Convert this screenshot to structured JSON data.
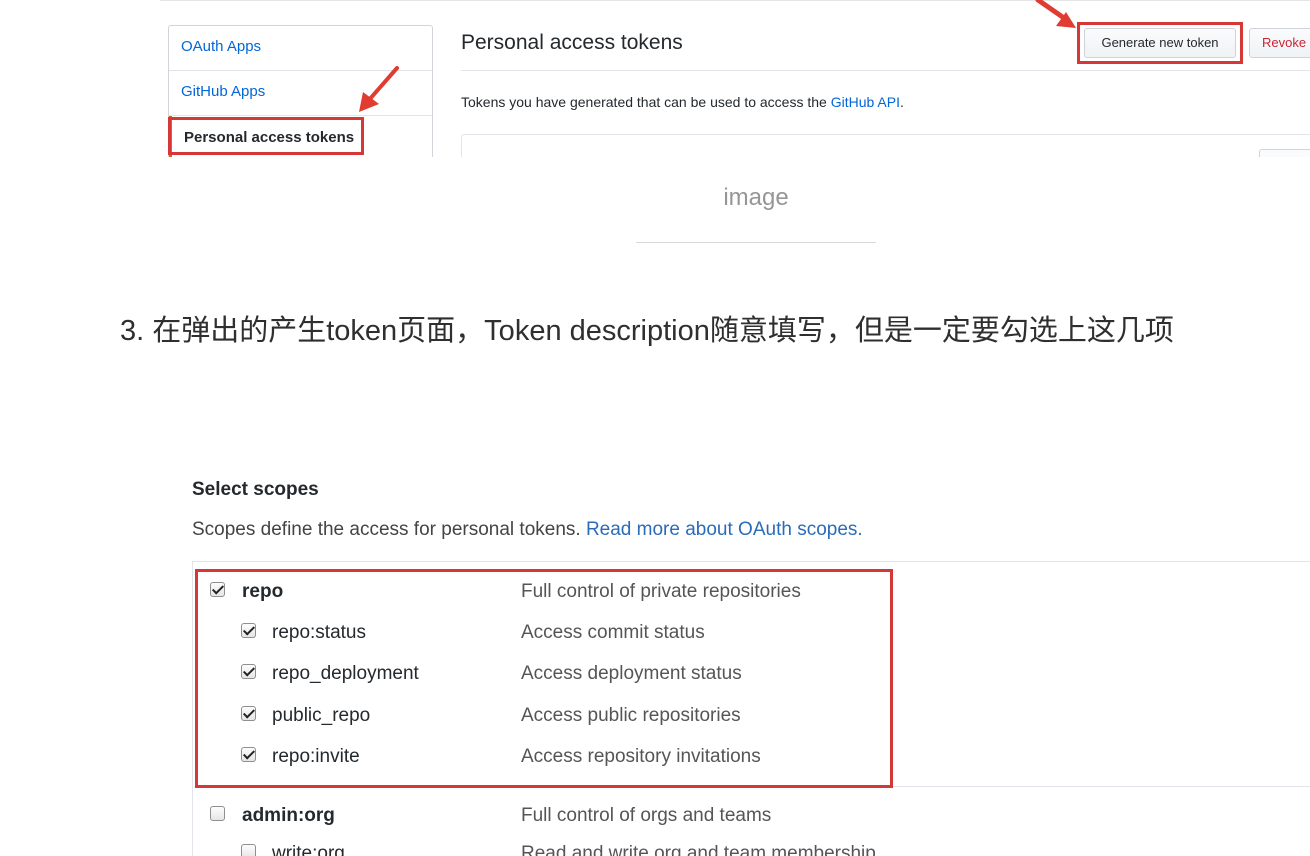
{
  "top_screenshot": {
    "sidebar": {
      "items": [
        {
          "label": "OAuth Apps"
        },
        {
          "label": "GitHub Apps"
        },
        {
          "label": "Personal access tokens"
        }
      ]
    },
    "title": "Personal access tokens",
    "generate_button": "Generate new token",
    "revoke_button": "Revoke",
    "description_prefix": "Tokens you have generated that can be used to access the ",
    "description_link": "GitHub API",
    "description_suffix": ".",
    "highlight_color": "#d63737"
  },
  "caption": "image",
  "step_text": "3. 在弹出的产生token页面，Token description随意填写，但是一定要勾选上这几项",
  "scopes": {
    "title": "Select scopes",
    "description": "Scopes define the access for personal tokens. ",
    "description_link": "Read more about OAuth scopes.",
    "rows": [
      {
        "name": "repo",
        "description": "Full control of private repositories",
        "checked": true
      },
      {
        "name": "repo:status",
        "description": "Access commit status",
        "checked": true
      },
      {
        "name": "repo_deployment",
        "description": "Access deployment status",
        "checked": true
      },
      {
        "name": "public_repo",
        "description": "Access public repositories",
        "checked": true
      },
      {
        "name": "repo:invite",
        "description": "Access repository invitations",
        "checked": true
      },
      {
        "name": "admin:org",
        "description": "Full control of orgs and teams",
        "checked": false
      },
      {
        "name": "write:org",
        "description": "Read and write org and team membership",
        "checked": false
      }
    ]
  }
}
